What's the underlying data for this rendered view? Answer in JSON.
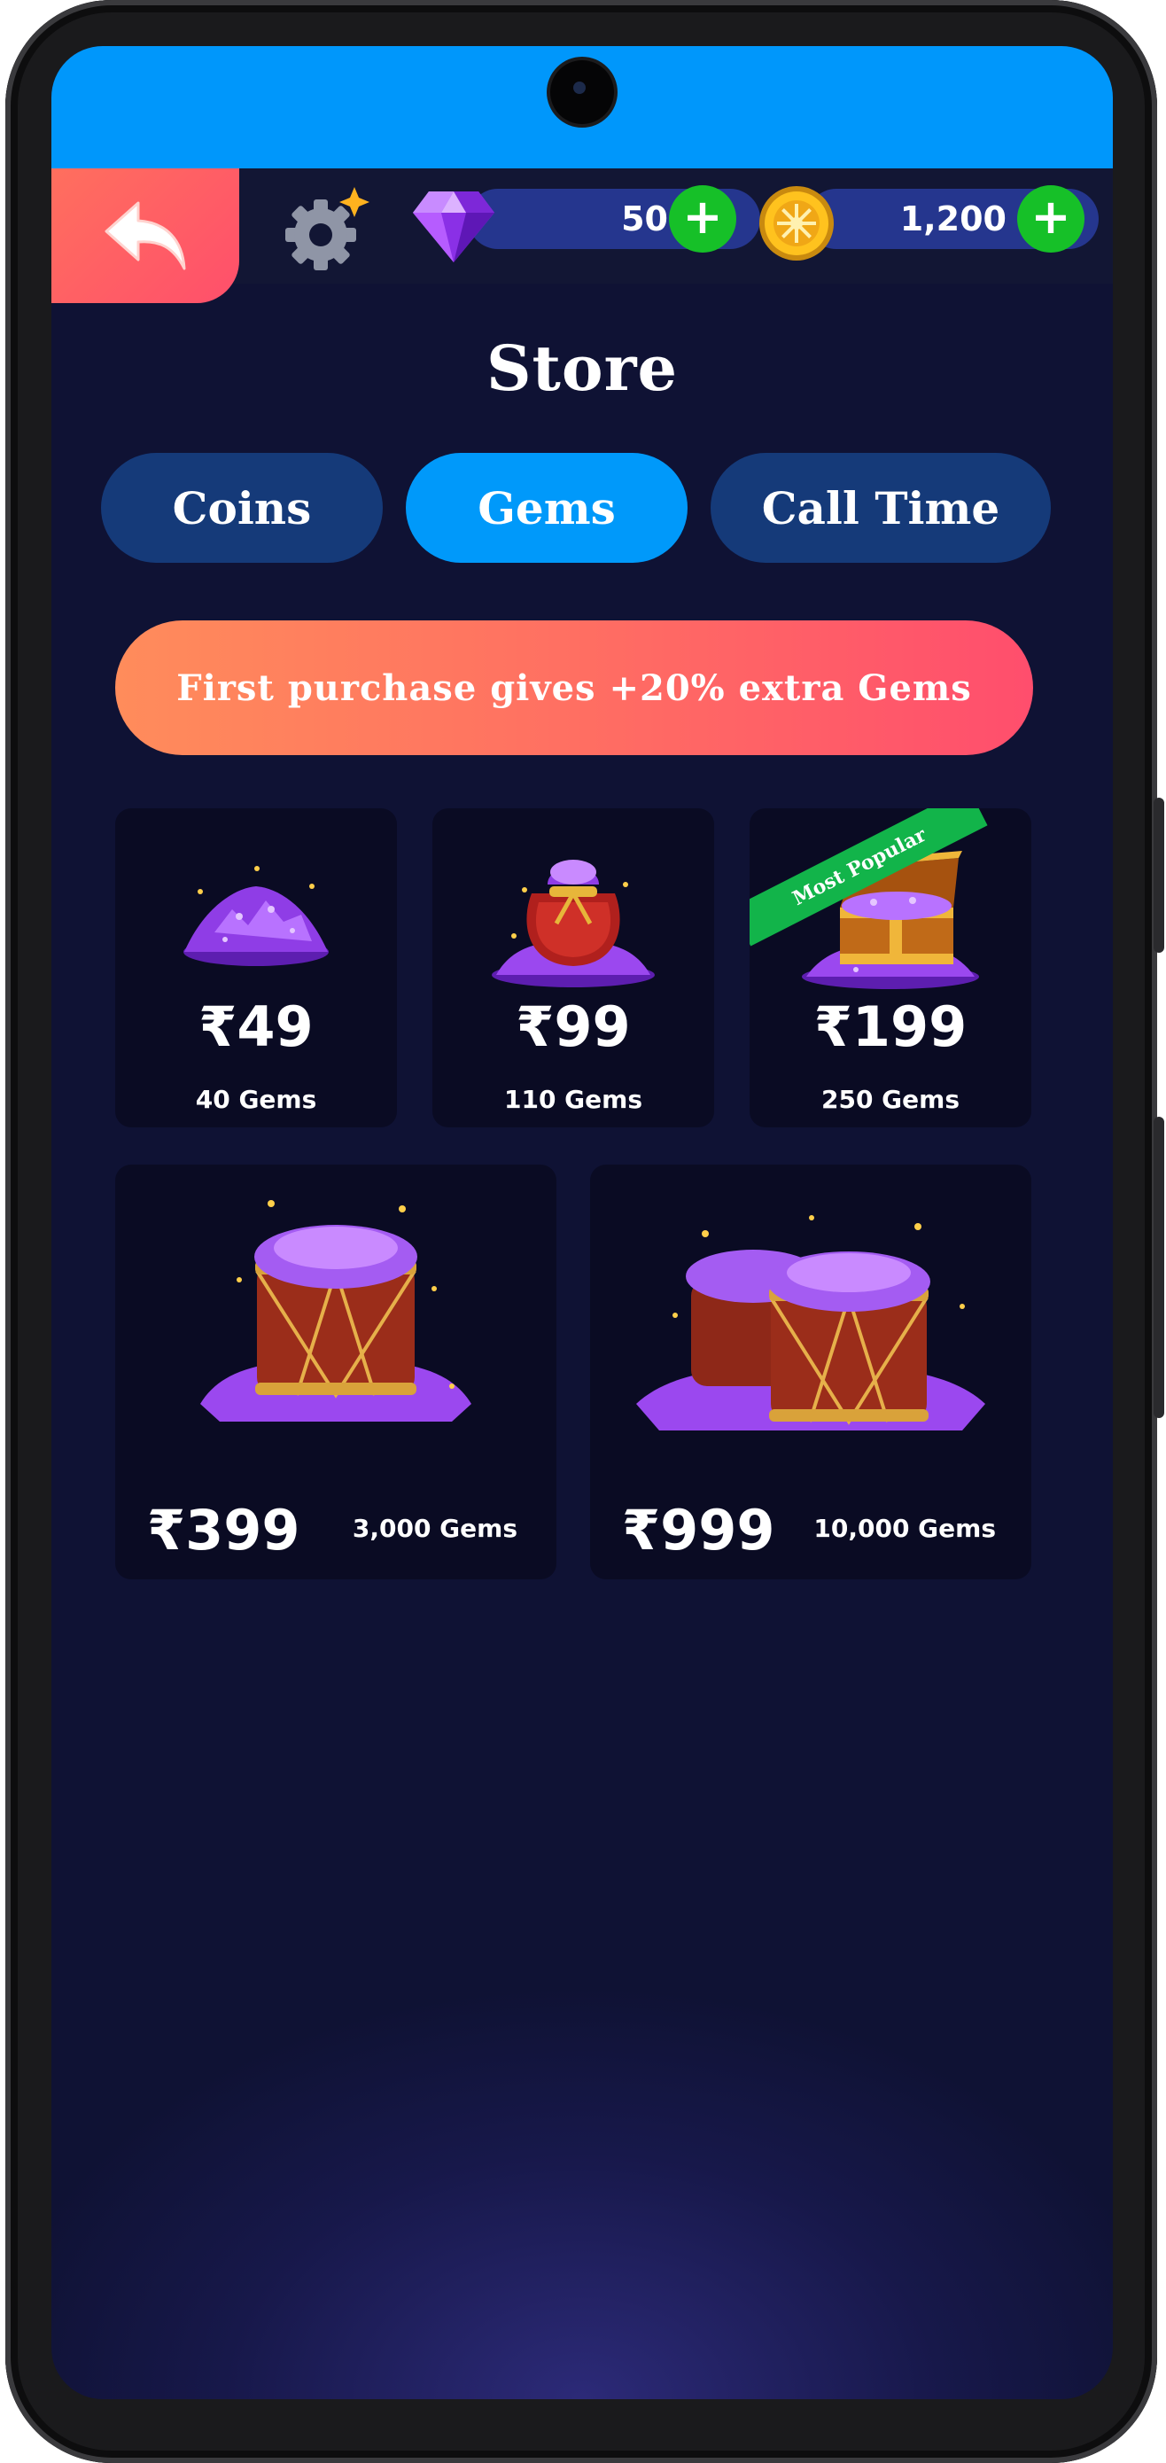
{
  "header": {
    "back_icon": "back-arrow-icon",
    "settings_icon": "gear-icon",
    "gems_balance": "50",
    "coins_balance": "1,200",
    "add_label": "+"
  },
  "store": {
    "title": "Store",
    "tabs": [
      {
        "label": "Coins",
        "active": false
      },
      {
        "label": "Gems",
        "active": true
      },
      {
        "label": "Call Time",
        "active": false
      }
    ],
    "banner": "First purchase gives +20% extra Gems",
    "packs": [
      {
        "price": "₹49",
        "quantity": "40 Gems"
      },
      {
        "price": "₹99",
        "quantity": "110 Gems"
      },
      {
        "price": "₹199",
        "quantity": "250 Gems",
        "badge": "Most Popular"
      },
      {
        "price": "₹399",
        "quantity": "3,000 Gems"
      },
      {
        "price": "₹999",
        "quantity": "10,000 Gems"
      }
    ]
  },
  "colors": {
    "status_bar": "#0097fb",
    "background": "#121540",
    "active_tab": "#0099fa",
    "inactive_tab": "#153a79",
    "banner_start": "#ff8c5b",
    "banner_end": "#ff4e6d",
    "plus_button": "#16c028",
    "badge": "#12b44a"
  }
}
